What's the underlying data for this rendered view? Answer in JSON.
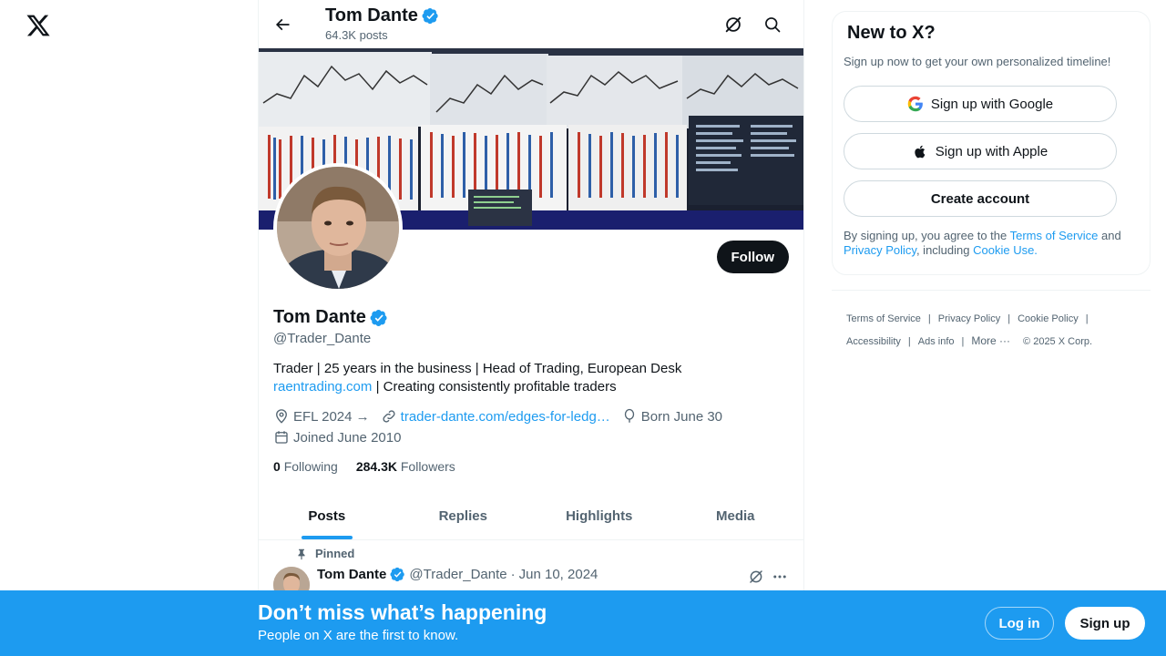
{
  "nav": {
    "logo_icon": "x-logo-icon"
  },
  "topbar": {
    "name": "Tom Dante",
    "posts": "64.3K posts",
    "icons": [
      "back-arrow-icon",
      "grok-icon",
      "search-icon"
    ]
  },
  "profile": {
    "name": "Tom Dante",
    "handle": "@Trader_Dante",
    "follow_label": "Follow",
    "bio_line1": "Trader | 25 years in the business | Head of Trading, European Desk",
    "bio_link": "raentrading.com",
    "bio_line2_rest": " | Creating consistently profitable traders",
    "location": "EFL 2024 →",
    "website": "trader-dante.com/edges-for-ledg…",
    "birthday": "Born June 30",
    "joined": "Joined June 2010",
    "following_count": "0",
    "following_label": "Following",
    "followers_count": "284.3K",
    "followers_label": "Followers"
  },
  "tabs": [
    {
      "label": "Posts",
      "active": true
    },
    {
      "label": "Replies",
      "active": false
    },
    {
      "label": "Highlights",
      "active": false
    },
    {
      "label": "Media",
      "active": false
    }
  ],
  "post": {
    "pinned_label": "Pinned",
    "author": "Tom Dante",
    "handle": "@Trader_Dante",
    "dot": "·",
    "date": "Jun 10, 2024"
  },
  "signup": {
    "title": "New to X?",
    "subtitle": "Sign up now to get your own personalized timeline!",
    "google_label": "Sign up with Google",
    "apple_label": "Sign up with Apple",
    "create_label": "Create account",
    "legal_prefix": "By signing up, you agree to the ",
    "terms_link": "Terms of Service",
    "legal_and": " and ",
    "privacy_link": "Privacy Policy",
    "legal_including": ", including ",
    "cookie_link": "Cookie Use."
  },
  "footer": {
    "terms": "Terms of Service",
    "privacy": "Privacy Policy",
    "cookie": "Cookie Policy",
    "accessibility": "Accessibility",
    "ads": "Ads info",
    "more": "More ···",
    "copyright": "© 2025 X Corp.",
    "separator": "|"
  },
  "bottom_bar": {
    "title": "Don’t miss what’s happening",
    "subtitle": "People on X are the first to know.",
    "login_label": "Log in",
    "signup_label": "Sign up"
  },
  "colors": {
    "accent": "#1d9bf0",
    "text": "#0f1419",
    "muted": "#536471",
    "border": "#eff3f4"
  }
}
